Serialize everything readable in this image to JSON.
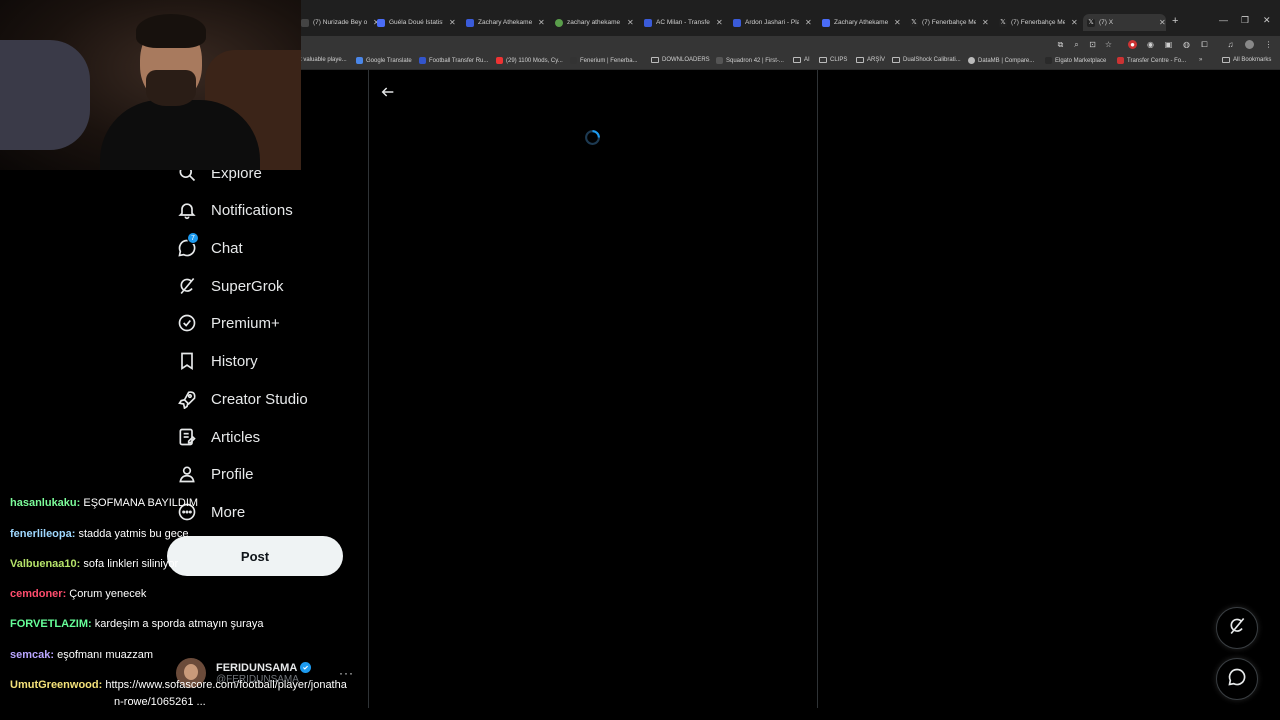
{
  "browser": {
    "tabs": [
      {
        "label": "(7) Nurizade Bey on",
        "color": "#444"
      },
      {
        "label": "Guéla Doué İstatistik",
        "color": "#4a6cf7"
      },
      {
        "label": "Zachary Athekame",
        "color": "#3a5bd9"
      },
      {
        "label": "zachary athekame",
        "color": "#5a9e4b"
      },
      {
        "label": "AC Milan - Transfer",
        "color": "#3a5bd9"
      },
      {
        "label": "Ardon Jashari - Play",
        "color": "#3a5bd9"
      },
      {
        "label": "Zachary Athekame",
        "color": "#4a6cf7"
      },
      {
        "label": "(7) Fenerbahçe Me",
        "color": "#222"
      },
      {
        "label": "(7) Fenerbahçe Me",
        "color": "#222"
      },
      {
        "label": "(7) X",
        "color": "#222"
      }
    ],
    "close_glyph": "✕",
    "new_tab": "+",
    "bookmarks": [
      {
        "label": "t valuable playe..."
      },
      {
        "label": "Google Translate"
      },
      {
        "label": "Football Transfer Ru..."
      },
      {
        "label": "(29) 1100 Mods, Cy..."
      },
      {
        "label": "Fenerium | Fenerba..."
      },
      {
        "label": "DOWNLOADERS"
      },
      {
        "label": "Squadron 42 | First-..."
      },
      {
        "label": "AI"
      },
      {
        "label": "CLIPS"
      },
      {
        "label": "ARŞİV"
      },
      {
        "label": "DualShock Calibrati..."
      },
      {
        "label": "DataMB | Compare..."
      },
      {
        "label": "Elgato Marketplace"
      },
      {
        "label": "Transfer Centre - Fo..."
      }
    ],
    "all_bookmarks": "All Bookmarks",
    "more_bookmarks": "»"
  },
  "nav": {
    "items": [
      {
        "label": "Explore",
        "icon": "search-icon"
      },
      {
        "label": "Notifications",
        "icon": "bell-icon"
      },
      {
        "label": "Chat",
        "icon": "chat-icon",
        "badge": "7"
      },
      {
        "label": "SuperGrok",
        "icon": "grok-icon"
      },
      {
        "label": "Premium+",
        "icon": "verified-badge-icon"
      },
      {
        "label": "History",
        "icon": "bookmark-icon"
      },
      {
        "label": "Creator Studio",
        "icon": "rocket-icon"
      },
      {
        "label": "Articles",
        "icon": "article-icon"
      },
      {
        "label": "Profile",
        "icon": "person-icon"
      },
      {
        "label": "More",
        "icon": "more-circle-icon"
      }
    ],
    "post_label": "Post"
  },
  "account": {
    "name": "FERIDUNSAMA",
    "handle": "@FERIDUNSAMA",
    "more": "···"
  },
  "chat_overlay": {
    "messages": [
      {
        "user": "hasanlukaku:",
        "text": " EŞOFMANA BAYILDIM",
        "color": "#7cfc9a"
      },
      {
        "user": "fenerlileopa:",
        "text": " stadda yatmis bu gece",
        "color": "#9fd8ff"
      },
      {
        "user": "Valbuenaa10:",
        "text": " sofa linkleri siliniyor",
        "color": "#b6e36a"
      },
      {
        "user": "cemdoner:",
        "text": " Çorum yenecek",
        "color": "#ff4d6d"
      },
      {
        "user": "FORVETLAZIM:",
        "text": " kardeşim a sporda atmayın şuraya",
        "color": "#66ff99"
      },
      {
        "user": "semcak:",
        "text": " eşofmanı muazzam",
        "color": "#b9a6ff"
      },
      {
        "user": "UmutGreenwood:",
        "text": " https://www.sofascore.com/football/player/jonatha",
        "color": "#f5e27a"
      }
    ],
    "last_line_cont": "n-rowe/1065261 ..."
  },
  "colors": {
    "accent": "#1d9bf0",
    "background": "#000000",
    "post_button": "#eff3f4"
  }
}
